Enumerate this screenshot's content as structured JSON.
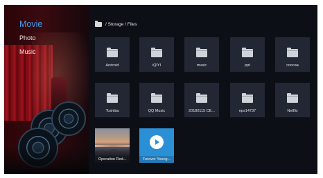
{
  "nav": {
    "items": [
      {
        "label": "Movie",
        "active": true
      },
      {
        "label": "Photo",
        "active": false
      },
      {
        "label": "Music",
        "active": false
      }
    ]
  },
  "breadcrumb": {
    "path": "/ Storage / Files",
    "icon": "folder-icon"
  },
  "files": {
    "folders_row1": [
      {
        "label": "Android",
        "icon": "folder-icon"
      },
      {
        "label": "iQIYI",
        "icon": "folder-icon"
      },
      {
        "label": "music",
        "icon": "folder-icon"
      },
      {
        "label": "ppt",
        "icon": "folder-icon"
      },
      {
        "label": "coocaa",
        "icon": "folder-icon"
      }
    ],
    "folders_row2": [
      {
        "label": "Toshiba",
        "icon": "folder-icon"
      },
      {
        "label": "QQ Music",
        "icon": "folder-icon"
      },
      {
        "label": "20180115 CE...",
        "icon": "folder-icon"
      },
      {
        "label": "eps14737",
        "icon": "folder-icon"
      },
      {
        "label": "Netflix",
        "icon": "folder-icon"
      }
    ],
    "media": [
      {
        "label": "Operation Red...",
        "type": "image"
      },
      {
        "label": "Forever Young...",
        "type": "video",
        "icon": "play-icon"
      }
    ]
  },
  "colors": {
    "accent": "#3f9cf0",
    "tile": "#222733",
    "video_tile": "#2b8fd6"
  }
}
